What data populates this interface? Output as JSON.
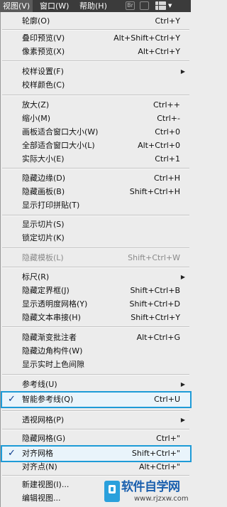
{
  "menubar": {
    "items": [
      "视图(V)",
      "窗口(W)",
      "帮助(H)"
    ],
    "br_label": "Br"
  },
  "menu": {
    "items": [
      {
        "label": "轮廓(O)",
        "shortcut": "Ctrl+Y"
      },
      {
        "label": "叠印预览(V)",
        "shortcut": "Alt+Shift+Ctrl+Y"
      },
      {
        "label": "像素预览(X)",
        "shortcut": "Alt+Ctrl+Y"
      },
      {
        "label": "校样设置(F)",
        "shortcut": ""
      },
      {
        "label": "校样颜色(C)",
        "shortcut": ""
      },
      {
        "label": "放大(Z)",
        "shortcut": "Ctrl++"
      },
      {
        "label": "缩小(M)",
        "shortcut": "Ctrl+-"
      },
      {
        "label": "画板适合窗口大小(W)",
        "shortcut": "Ctrl+0"
      },
      {
        "label": "全部适合窗口大小(L)",
        "shortcut": "Alt+Ctrl+0"
      },
      {
        "label": "实际大小(E)",
        "shortcut": "Ctrl+1"
      },
      {
        "label": "隐藏边缘(D)",
        "shortcut": "Ctrl+H"
      },
      {
        "label": "隐藏画板(B)",
        "shortcut": "Shift+Ctrl+H"
      },
      {
        "label": "显示打印拼贴(T)",
        "shortcut": ""
      },
      {
        "label": "显示切片(S)",
        "shortcut": ""
      },
      {
        "label": "锁定切片(K)",
        "shortcut": ""
      },
      {
        "label": "隐藏模板(L)",
        "shortcut": "Shift+Ctrl+W"
      },
      {
        "label": "标尺(R)",
        "shortcut": ""
      },
      {
        "label": "隐藏定界框(J)",
        "shortcut": "Shift+Ctrl+B"
      },
      {
        "label": "显示透明度网格(Y)",
        "shortcut": "Shift+Ctrl+D"
      },
      {
        "label": "隐藏文本串接(H)",
        "shortcut": "Shift+Ctrl+Y"
      },
      {
        "label": "隐藏渐变批注者",
        "shortcut": "Alt+Ctrl+G"
      },
      {
        "label": "隐藏边角构件(W)",
        "shortcut": ""
      },
      {
        "label": "显示实时上色间隙",
        "shortcut": ""
      },
      {
        "label": "参考线(U)",
        "shortcut": ""
      },
      {
        "label": "智能参考线(Q)",
        "shortcut": "Ctrl+U"
      },
      {
        "label": "透视网格(P)",
        "shortcut": ""
      },
      {
        "label": "隐藏网格(G)",
        "shortcut": "Ctrl+\""
      },
      {
        "label": "对齐网格",
        "shortcut": "Shift+Ctrl+\""
      },
      {
        "label": "对齐点(N)",
        "shortcut": "Alt+Ctrl+\""
      },
      {
        "label": "新建视图(I)...",
        "shortcut": ""
      },
      {
        "label": "编辑视图...",
        "shortcut": ""
      }
    ],
    "check_mark": "✓",
    "submenu_arrow": "▶"
  },
  "watermark": {
    "title": "软件自学网",
    "url": "www.rjzxw.com"
  }
}
